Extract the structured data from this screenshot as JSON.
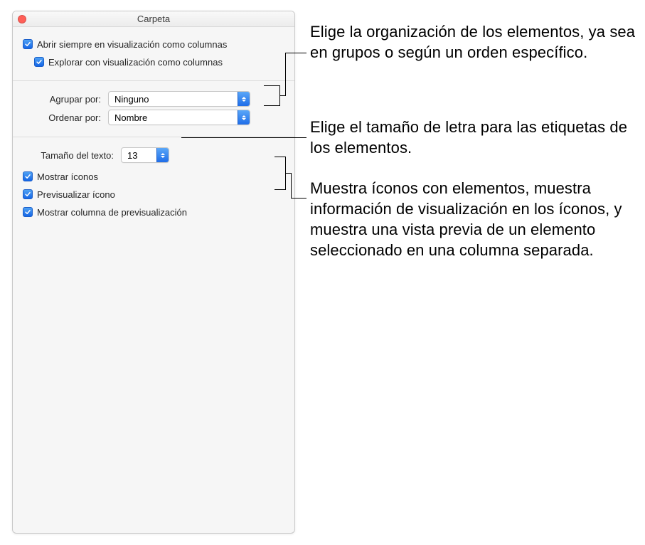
{
  "window": {
    "title": "Carpeta"
  },
  "section_view": {
    "always_open": "Abrir siempre en visualización como columnas",
    "browse": "Explorar con visualización como columnas"
  },
  "section_arrange": {
    "group_by_label": "Agrupar por:",
    "group_by_value": "Ninguno",
    "sort_by_label": "Ordenar por:",
    "sort_by_value": "Nombre"
  },
  "section_text": {
    "text_size_label": "Tamaño del texto:",
    "text_size_value": "13",
    "show_icons": "Mostrar íconos",
    "preview_icon": "Previsualizar ícono",
    "show_preview_column": "Mostrar columna de previsualización"
  },
  "callouts": {
    "c1": "Elige la organización de los elementos, ya sea en grupos o según un orden específico.",
    "c2": "Elige el tamaño de letra para las etiquetas de los elementos.",
    "c3": "Muestra íconos con elementos, muestra información de visualización en los íconos, y muestra una vista previa de un elemento seleccionado en una columna separada."
  }
}
